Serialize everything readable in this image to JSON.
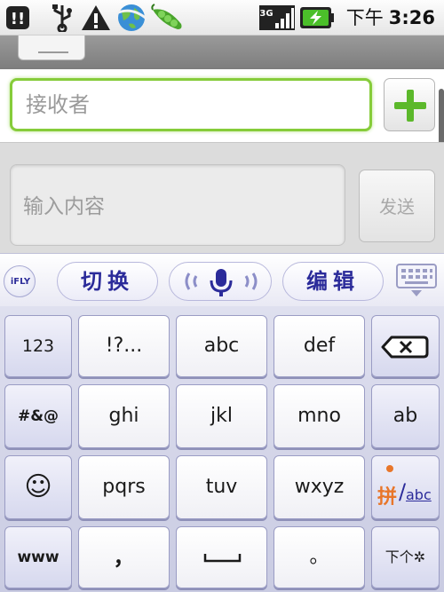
{
  "status_bar": {
    "icons": [
      "notification-icon",
      "usb-icon",
      "warning-icon",
      "globe-icon",
      "peapod-icon",
      "signal-icon",
      "battery-charging-icon"
    ],
    "network_label": "3G",
    "ampm": "下午",
    "time": "3:26"
  },
  "compose": {
    "recipient_placeholder": "接收者",
    "message_placeholder": "输入内容",
    "send_label": "发送"
  },
  "keyboard": {
    "logo": "iFLY",
    "toolbar": {
      "switch_label": "切换",
      "edit_label": "编辑"
    },
    "keys": {
      "num": "123",
      "punct": "!?...",
      "abc": "abc",
      "def": "def",
      "sym": "#&@",
      "ghi": "ghi",
      "jkl": "jkl",
      "mno": "mno",
      "ab": "ab",
      "emoji": "☺",
      "pqrs": "pqrs",
      "tuv": "tuv",
      "wxyz": "wxyz",
      "pin": "拼",
      "pin_abc": "abc",
      "www": "www",
      "comma": "，",
      "period": "。",
      "next": "下个"
    }
  },
  "colors": {
    "recipient_focus_border": "#86cc3a",
    "add_button_plus": "#5cb82b",
    "keyboard_text": "#2b2b9a",
    "pinyin_orange": "#e8762a"
  }
}
